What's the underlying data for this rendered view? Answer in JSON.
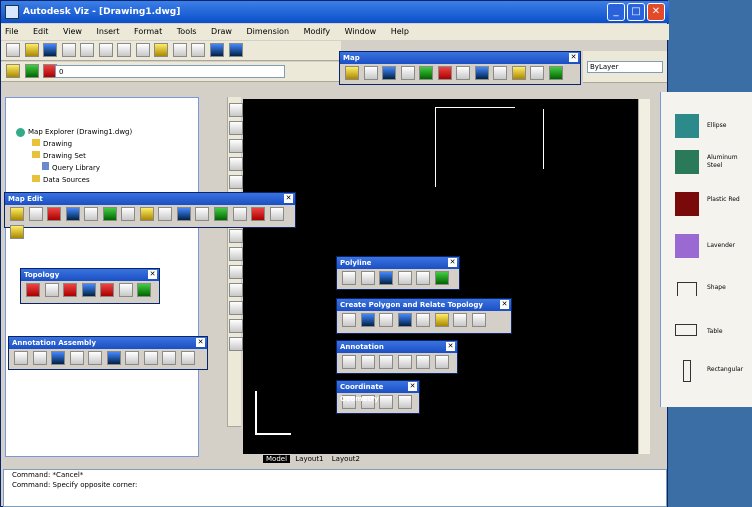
{
  "window": {
    "title": "Autodesk Viz - [Drawing1.dwg]"
  },
  "menubar": [
    "File",
    "Edit",
    "View",
    "Insert",
    "Format",
    "Tools",
    "Draw",
    "Dimension",
    "Modify",
    "Window",
    "Help"
  ],
  "toolbar": {
    "layer_combo": "0",
    "linetype_combo": "ByLayer"
  },
  "floating": {
    "map_toolbar": "Map",
    "map_edit": "Map Edit",
    "topology": "Topology",
    "annotation": "Annotation Assembly",
    "polyline": "Polyline",
    "polygon_topology": "Create Polygon and Relate Topology",
    "annotation_small": "Annotation",
    "coordinate_geometry": "Coordinate Geometry"
  },
  "tree": {
    "root": "Map Explorer (Drawing1.dwg)",
    "items": [
      "Drawing",
      "Drawing Set",
      "Query Library",
      "Data Sources"
    ]
  },
  "layout_tabs": [
    "Model",
    "Layout1",
    "Layout2"
  ],
  "command": {
    "line1": "Command: *Cancel*",
    "line2": "Command: Specify opposite corner:"
  },
  "right_panel": {
    "items": [
      {
        "label": "Ellipse",
        "color": "#2d8a8a"
      },
      {
        "label": "Aluminum Steel",
        "color": "#2a7a5a"
      },
      {
        "label": "Plastic Red",
        "color": "#7a0a0a"
      },
      {
        "label": "Lavender",
        "color": "#9a6ad2"
      },
      {
        "label": "Shape",
        "color": "#ffffff"
      },
      {
        "label": "Table",
        "color": "#ffffff"
      },
      {
        "label": "Rectangular",
        "color": "#ffffff"
      }
    ]
  }
}
